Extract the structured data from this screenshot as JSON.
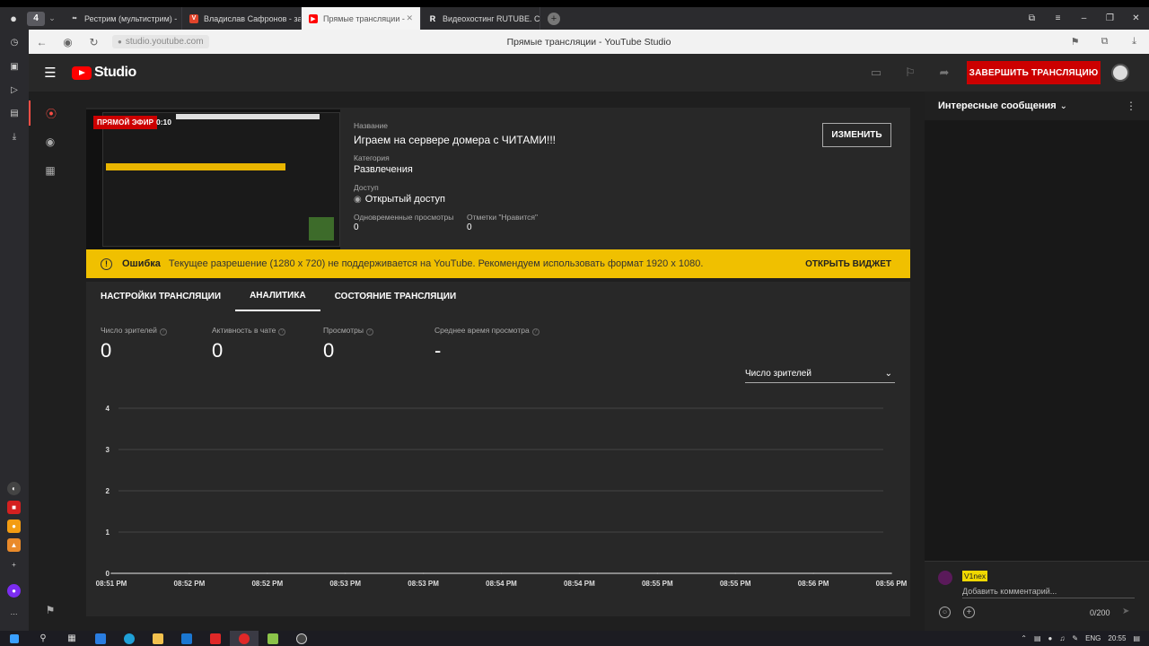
{
  "browser": {
    "tab_count": "4",
    "tabs": [
      {
        "label": "Рестрим (мультистрим) -",
        "icon": "infinity-icon",
        "color": "#ffffff"
      },
      {
        "label": "Владислав Сафронов - за",
        "icon": "red-logo-icon",
        "color": "#e0442b"
      },
      {
        "label": "Прямые трансляции -",
        "icon": "youtube-icon",
        "color": "#ff0000",
        "active": true
      },
      {
        "label": "Видеохостинг RUTUBE. Св",
        "icon": "rutube-icon",
        "color": "#ffffff"
      }
    ],
    "url": "studio.youtube.com",
    "page_title": "Прямые трансляции - YouTube Studio"
  },
  "studio": {
    "logo_text": "Studio",
    "end_stream_label": "ЗАВЕРШИТЬ ТРАНСЛЯЦИЮ",
    "stream": {
      "live_badge": "ПРЯМОЙ ЭФИР",
      "live_time": "0:10",
      "title_label": "Название",
      "title": "Играем на сервере домера с ЧИТАМИ!!!",
      "category_label": "Категория",
      "category": "Развлечения",
      "access_label": "Доступ",
      "access": "Открытый доступ",
      "concurrent_label": "Одновременные просмотры",
      "concurrent": "0",
      "likes_label": "Отметки \"Нравится\"",
      "likes": "0",
      "edit_label": "ИЗМЕНИТЬ"
    },
    "error": {
      "title": "Ошибка",
      "message": "Текущее разрешение (1280 x 720) не поддерживается на YouTube. Рекомендуем использовать формат 1920 x 1080.",
      "action": "ОТКРЫТЬ ВИДЖЕТ"
    },
    "tabs": [
      "НАСТРОЙКИ ТРАНСЛЯЦИИ",
      "АНАЛИТИКА",
      "СОСТОЯНИЕ ТРАНСЛЯЦИИ"
    ],
    "metrics": [
      {
        "label": "Число зрителей",
        "value": "0"
      },
      {
        "label": "Активность в чате",
        "value": "0"
      },
      {
        "label": "Просмотры",
        "value": "0"
      },
      {
        "label": "Среднее время просмотра",
        "value": "-"
      }
    ],
    "metric_select": "Число зрителей"
  },
  "chart_data": {
    "type": "line",
    "x": [
      "08:51 PM",
      "08:52 PM",
      "08:52 PM",
      "08:53 PM",
      "08:53 PM",
      "08:54 PM",
      "08:54 PM",
      "08:55 PM",
      "08:55 PM",
      "08:56 PM",
      "08:56 PM"
    ],
    "series": [
      {
        "values": [
          0,
          0,
          0,
          0,
          0,
          0,
          0,
          0,
          0,
          0,
          0
        ]
      }
    ],
    "yticks": [
      "0",
      "1",
      "2",
      "3",
      "4"
    ],
    "ylim": [
      0,
      4
    ],
    "grid": true,
    "line_color": "#aaaaaa"
  },
  "chat": {
    "header": "Интересные сообщения",
    "user": "V1nex",
    "placeholder": "Добавить комментарий...",
    "counter": "0/200"
  },
  "taskbar": {
    "lang": "ENG",
    "time": "20:55"
  }
}
